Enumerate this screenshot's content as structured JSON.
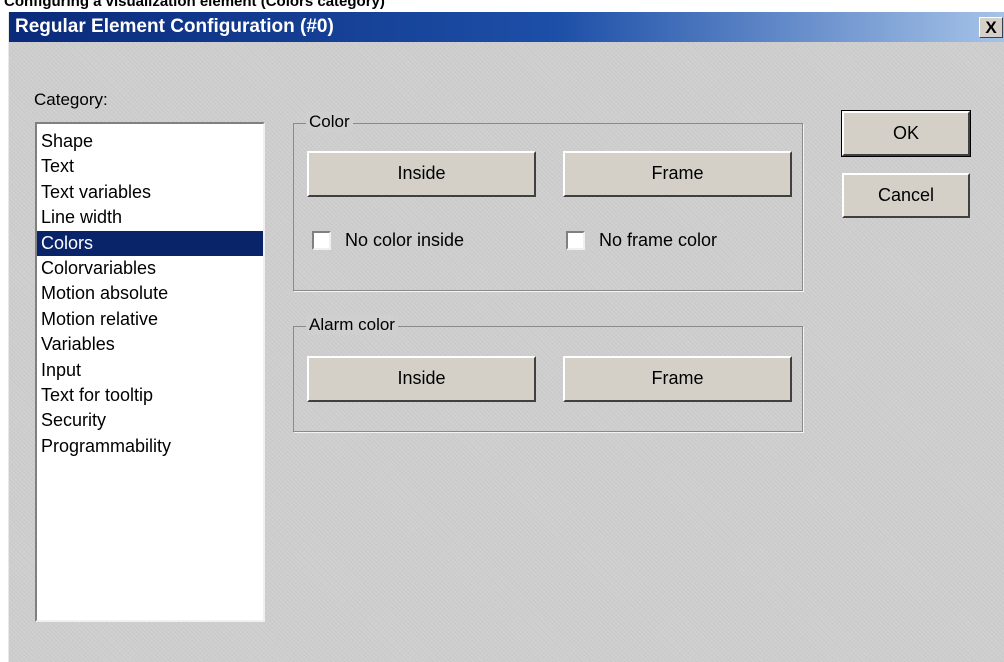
{
  "caption": "Configuring a visualization element (Colors category)",
  "window": {
    "title": "Regular Element Configuration (#0)",
    "close_symbol": "X"
  },
  "category": {
    "label": "Category:",
    "items": [
      "Shape",
      "Text",
      "Text variables",
      "Line width",
      "Colors",
      "Colorvariables",
      "Motion absolute",
      "Motion relative",
      "Variables",
      "Input",
      "Text for tooltip",
      "Security",
      "Programmability"
    ],
    "selected": "Colors"
  },
  "color_group": {
    "title": "Color",
    "inside_label": "Inside",
    "frame_label": "Frame",
    "no_inside_label": "No color inside",
    "no_frame_label": "No frame color",
    "no_inside_checked": false,
    "no_frame_checked": false
  },
  "alarm_group": {
    "title": "Alarm color",
    "inside_label": "Inside",
    "frame_label": "Frame"
  },
  "buttons": {
    "ok": "OK",
    "cancel": "Cancel"
  },
  "colors": {
    "selection": "#0a246a",
    "dialog_face": "#cfcfcf",
    "title_start": "#0a2a7a",
    "title_end": "#a6c3e8"
  }
}
